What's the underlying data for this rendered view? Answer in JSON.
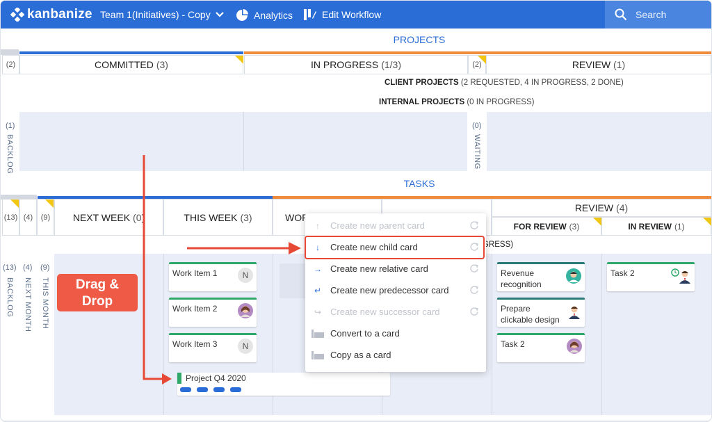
{
  "topbar": {
    "logo": "kanbanize",
    "board": "Team 1(Initiatives) - Copy",
    "analytics": "Analytics",
    "edit_workflow": "Edit Workflow",
    "search_placeholder": "Search"
  },
  "colors": {
    "primary": "#2a6dd6",
    "orange": "#ef8b3a",
    "green": "#2fa86a",
    "lane": "#e9edf7",
    "callout": "#ef5a47"
  },
  "projects": {
    "title": "PROJECTS",
    "left_count": "(2)",
    "committed": {
      "label": "COMMITTED",
      "count": "(3)"
    },
    "in_progress": {
      "label": "IN PROGRESS",
      "count": "(1/3)"
    },
    "mid_count": "(2)",
    "review": {
      "label": "REVIEW",
      "count": "(1)"
    },
    "client_label": "CLIENT PROJECTS",
    "client_counts": "(2 REQUESTED, 4 IN PROGRESS, 2 DONE)",
    "internal_label": "INTERNAL PROJECTS",
    "internal_counts": "(0 IN PROGRESS)",
    "backlog_count": "(1)",
    "backlog_label": "BACKLOG",
    "waiting_count": "(0)",
    "waiting_label": "WAITING"
  },
  "tasks": {
    "title": "TASKS",
    "c1": "(13)",
    "c2": "(4)",
    "c3": "(9)",
    "next_week": {
      "label": "NEXT WEEK",
      "count": "(0)"
    },
    "this_week": {
      "label": "THIS WEEK",
      "count": "(3)"
    },
    "wor": "WOR",
    "review": {
      "label": "REVIEW",
      "count": "(4)"
    },
    "for_review": {
      "label": "FOR REVIEW",
      "count": "(3)"
    },
    "in_review": {
      "label": "IN REVIEW",
      "count": "(1)"
    },
    "gress": "GRESS)",
    "lane_counts": [
      "(13)",
      "(4)",
      "(9)"
    ],
    "lane_labels": [
      "BACKLOG",
      "NEXT MONTH",
      "THIS MONTH"
    ],
    "cards_this_week": [
      {
        "title": "Work Item 1",
        "avatar": "N"
      },
      {
        "title": "Work Item 2",
        "avatar": ""
      },
      {
        "title": "Work Item 3",
        "avatar": "N"
      }
    ],
    "cards_review": [
      {
        "title": "Revenue recognition"
      },
      {
        "title": "Prepare clickable design"
      },
      {
        "title": "Task 2"
      }
    ],
    "in_review_card": "Task 2",
    "project_card": "Project Q4 2020"
  },
  "callout": {
    "line1": "Drag &",
    "line2": "Drop"
  },
  "context_menu": [
    {
      "label": "Create new parent card",
      "disabled": true,
      "icon": "arrow-up-icon"
    },
    {
      "label": "Create new child card",
      "disabled": false,
      "icon": "arrow-down-icon",
      "highlighted": true
    },
    {
      "label": "Create new relative card",
      "disabled": false,
      "icon": "arrow-right-icon"
    },
    {
      "label": "Create new predecessor card",
      "disabled": false,
      "icon": "return-icon"
    },
    {
      "label": "Create new successor card",
      "disabled": true,
      "icon": "successor-icon"
    },
    {
      "label": "Convert to a card",
      "disabled": false,
      "icon": "convert-icon"
    },
    {
      "label": "Copy as a card",
      "disabled": false,
      "icon": "copy-icon"
    }
  ]
}
